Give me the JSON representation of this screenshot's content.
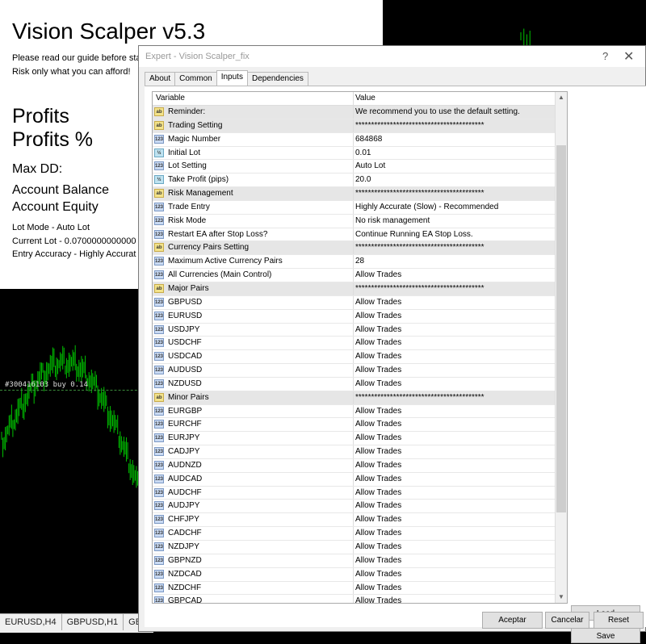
{
  "panel": {
    "title": "Vision Scalper v5.3",
    "guide": "Please read our guide before sta",
    "risk": "Risk only what you can afford!",
    "profits": "Profits",
    "profits_pct": "Profits %",
    "max_dd": "Max DD:",
    "balance": "Account Balance",
    "equity": "Account Equity",
    "lot_mode": "Lot Mode - Auto Lot",
    "current_lot": "Current Lot - 0.0700000000000",
    "entry_accuracy": "Entry Accuracy - Highly Accurat"
  },
  "chart": {
    "trade_label": "#300416103 buy 0.14",
    "tabs": [
      "EURUSD,H4",
      "GBPUSD,H1",
      "GBP"
    ]
  },
  "dialog": {
    "title": "Expert - Vision Scalper_fix",
    "help": "?",
    "close": "✕",
    "tabs": [
      "About",
      "Common",
      "Inputs",
      "Dependencies"
    ],
    "col_variable": "Variable",
    "col_value": "Value",
    "rows": [
      {
        "icon": "ab",
        "variable": "Reminder:",
        "value": "We recommend you to use the default setting."
      },
      {
        "icon": "ab",
        "variable": "Trading Setting",
        "value": "*****************************************"
      },
      {
        "icon": "123",
        "variable": "Magic Number",
        "value": "684868"
      },
      {
        "icon": "½",
        "variable": "Initial Lot",
        "value": "0.01"
      },
      {
        "icon": "123",
        "variable": "Lot Setting",
        "value": "Auto Lot"
      },
      {
        "icon": "½",
        "variable": "Take Profit (pips)",
        "value": "20.0"
      },
      {
        "icon": "ab",
        "variable": "Risk Management",
        "value": "*****************************************"
      },
      {
        "icon": "123",
        "variable": "Trade Entry",
        "value": "Highly Accurate (Slow) - Recommended"
      },
      {
        "icon": "123",
        "variable": "Risk Mode",
        "value": "No risk management"
      },
      {
        "icon": "123",
        "variable": "Restart EA after Stop Loss?",
        "value": "Continue Running EA Stop Loss."
      },
      {
        "icon": "ab",
        "variable": "Currency Pairs Setting",
        "value": "*****************************************"
      },
      {
        "icon": "123",
        "variable": "Maximum Active Currency Pairs",
        "value": "28"
      },
      {
        "icon": "123",
        "variable": "All Currencies (Main Control)",
        "value": "Allow Trades"
      },
      {
        "icon": "ab",
        "variable": "Major Pairs",
        "value": "*****************************************"
      },
      {
        "icon": "123",
        "variable": "GBPUSD",
        "value": "Allow Trades"
      },
      {
        "icon": "123",
        "variable": "EURUSD",
        "value": "Allow Trades"
      },
      {
        "icon": "123",
        "variable": "USDJPY",
        "value": "Allow Trades"
      },
      {
        "icon": "123",
        "variable": "USDCHF",
        "value": "Allow Trades"
      },
      {
        "icon": "123",
        "variable": "USDCAD",
        "value": "Allow Trades"
      },
      {
        "icon": "123",
        "variable": "AUDUSD",
        "value": "Allow Trades"
      },
      {
        "icon": "123",
        "variable": "NZDUSD",
        "value": "Allow Trades"
      },
      {
        "icon": "ab",
        "variable": "Minor Pairs",
        "value": "*****************************************"
      },
      {
        "icon": "123",
        "variable": "EURGBP",
        "value": "Allow Trades"
      },
      {
        "icon": "123",
        "variable": "EURCHF",
        "value": "Allow Trades"
      },
      {
        "icon": "123",
        "variable": "EURJPY",
        "value": "Allow Trades"
      },
      {
        "icon": "123",
        "variable": "CADJPY",
        "value": "Allow Trades"
      },
      {
        "icon": "123",
        "variable": "AUDNZD",
        "value": "Allow Trades"
      },
      {
        "icon": "123",
        "variable": "AUDCAD",
        "value": "Allow Trades"
      },
      {
        "icon": "123",
        "variable": "AUDCHF",
        "value": "Allow Trades"
      },
      {
        "icon": "123",
        "variable": "AUDJPY",
        "value": "Allow Trades"
      },
      {
        "icon": "123",
        "variable": "CHFJPY",
        "value": "Allow Trades"
      },
      {
        "icon": "123",
        "variable": "CADCHF",
        "value": "Allow Trades"
      },
      {
        "icon": "123",
        "variable": "NZDJPY",
        "value": "Allow Trades"
      },
      {
        "icon": "123",
        "variable": "GBPNZD",
        "value": "Allow Trades"
      },
      {
        "icon": "123",
        "variable": "NZDCAD",
        "value": "Allow Trades"
      },
      {
        "icon": "123",
        "variable": "NZDCHF",
        "value": "Allow Trades"
      },
      {
        "icon": "123",
        "variable": "GBPCAD",
        "value": "Allow Trades"
      }
    ],
    "load": "Load",
    "save": "Save",
    "ok": "Aceptar",
    "cancel": "Cancelar",
    "reset": "Reset"
  },
  "colors": {
    "candle": "#00c000",
    "dialog_bg": "#f0f0f0",
    "row_alt": "#e6e6e6"
  }
}
